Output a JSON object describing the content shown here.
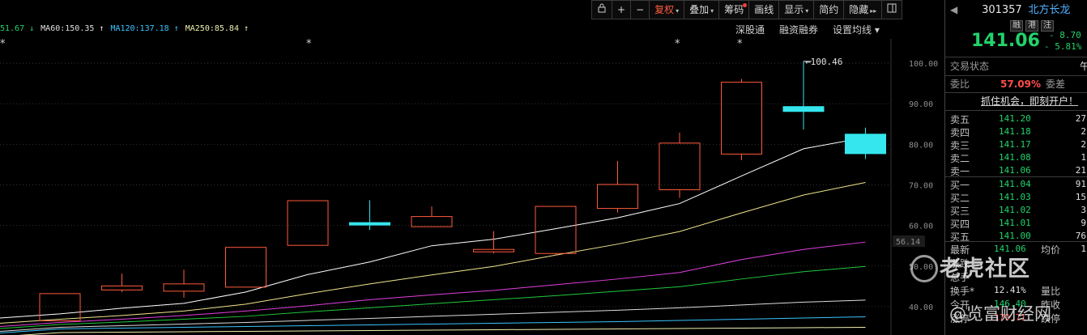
{
  "toolbar": {
    "items": [
      {
        "label": "",
        "icon": "lock-icon"
      },
      {
        "label": "+"
      },
      {
        "label": "−"
      },
      {
        "label": "复权",
        "dropdown": true,
        "active": true
      },
      {
        "label": "叠加",
        "dropdown": true
      },
      {
        "label": "筹码",
        "dot": true
      },
      {
        "label": "画线"
      },
      {
        "label": "显示",
        "dropdown": true
      },
      {
        "label": "简约"
      },
      {
        "label": "隐藏",
        "suffix": "▸▸"
      },
      {
        "label": "",
        "icon": "panel-toggle-icon"
      }
    ]
  },
  "ma_line": [
    {
      "label": "51.67",
      "arrow": "↓",
      "color": "#22d36b"
    },
    {
      "label": "MA60:150.35",
      "arrow": "↑",
      "color": "#e0e0e0"
    },
    {
      "label": "MA120:137.18",
      "arrow": "↑",
      "color": "#39c4ff"
    },
    {
      "label": "MA250:85.84",
      "arrow": "↑",
      "color": "#f0f0b0"
    }
  ],
  "subbar": {
    "items": [
      "深股通",
      "融资融券",
      "设置均线 ▾"
    ]
  },
  "chart_data": {
    "type": "candlestick",
    "ylim": [
      33,
      106
    ],
    "y_ticks": [
      40,
      50,
      60,
      70,
      80,
      90,
      100
    ],
    "current_price_label": "56.14",
    "current_price": 56.14,
    "high_annotation": "100.46",
    "colors": {
      "up": "#ff5a3c",
      "down": "#35e6ee",
      "background": "#000000",
      "grid": "#333333"
    },
    "candles": [
      {
        "open": 36.5,
        "close": 43.2,
        "high": 43.2,
        "low": 36.5
      },
      {
        "open": 44.1,
        "close": 45.1,
        "high": 48.1,
        "low": 43.6
      },
      {
        "open": 43.8,
        "close": 45.6,
        "high": 49.1,
        "low": 42.2
      },
      {
        "open": 44.8,
        "close": 54.6,
        "high": 54.6,
        "low": 44.8
      },
      {
        "open": 55.1,
        "close": 66.1,
        "high": 66.1,
        "low": 55.1
      },
      {
        "open": 60.7,
        "close": 60.2,
        "high": 66.2,
        "low": 58.9
      },
      {
        "open": 59.7,
        "close": 62.2,
        "high": 64.7,
        "low": 59.7
      },
      {
        "open": 53.6,
        "close": 54.1,
        "high": 58.6,
        "low": 53.1
      },
      {
        "open": 53.1,
        "close": 64.7,
        "high": 64.7,
        "low": 52.6
      },
      {
        "open": 64.2,
        "close": 70.1,
        "high": 75.9,
        "low": 63.2
      },
      {
        "open": 68.8,
        "close": 80.3,
        "high": 82.9,
        "low": 66.8
      },
      {
        "open": 77.6,
        "close": 95.3,
        "high": 96.1,
        "low": 76.1
      },
      {
        "open": 89.3,
        "close": 88.1,
        "high": 100.46,
        "low": 83.6
      },
      {
        "open": 82.5,
        "close": 77.7,
        "high": 84.1,
        "low": 76.4
      }
    ],
    "ma_lines": [
      {
        "color": "#ffffff",
        "values": [
          38.2,
          39.6,
          40.8,
          43.6,
          47.9,
          51.0,
          55.0,
          56.6,
          59.2,
          61.9,
          65.4,
          72.2,
          78.9,
          81.7
        ]
      },
      {
        "color": "#f0e68c",
        "values": [
          36.9,
          37.8,
          38.9,
          40.6,
          43.2,
          45.6,
          47.8,
          49.9,
          52.7,
          55.4,
          58.5,
          63.1,
          67.5,
          70.6
        ]
      },
      {
        "color": "#e040e0",
        "values": [
          36.1,
          36.9,
          37.8,
          38.9,
          40.2,
          41.7,
          42.9,
          44.0,
          45.4,
          46.8,
          48.4,
          51.6,
          54.1,
          55.9
        ]
      },
      {
        "color": "#22c93a",
        "values": [
          35.6,
          36.2,
          36.9,
          37.6,
          38.7,
          39.7,
          40.7,
          41.7,
          42.7,
          43.8,
          44.9,
          46.8,
          48.6,
          49.9
        ]
      },
      {
        "color": "#dcdcdc",
        "values": [
          34.9,
          35.3,
          35.7,
          36.1,
          36.6,
          37.1,
          37.6,
          38.1,
          38.6,
          39.1,
          39.7,
          40.4,
          41.1,
          41.6
        ]
      },
      {
        "color": "#39c4ff",
        "values": [
          34.5,
          34.7,
          34.9,
          35.1,
          35.3,
          35.5,
          35.7,
          35.9,
          36.1,
          36.3,
          36.6,
          36.9,
          37.2,
          37.5
        ]
      },
      {
        "color": "#f0f0b0",
        "values": [
          33.6,
          33.7,
          33.8,
          33.9,
          34.0,
          34.1,
          34.2,
          34.3,
          34.4,
          34.5,
          34.6,
          34.7,
          34.8,
          34.9
        ]
      }
    ],
    "star_markers": [
      0,
      5,
      11,
      12
    ]
  },
  "panel": {
    "code": "301357",
    "name": "北方长龙",
    "badges": [
      "融",
      "港",
      "注"
    ],
    "price": "141.06",
    "change": "- 8.70",
    "change_pct": "- 5.81%",
    "status_label": "交易状态",
    "status_value": "午",
    "weibi_label": "委比",
    "weibi_value": "57.09%",
    "weicha_label": "委差",
    "promo": "抓住机会，即刻开户！",
    "asks": [
      {
        "label": "卖五",
        "price": "141.20",
        "vol": "27"
      },
      {
        "label": "卖四",
        "price": "141.18",
        "vol": "2"
      },
      {
        "label": "卖三",
        "price": "141.17",
        "vol": "2"
      },
      {
        "label": "卖二",
        "price": "141.08",
        "vol": "1"
      },
      {
        "label": "卖一",
        "price": "141.06",
        "vol": "21"
      }
    ],
    "bids": [
      {
        "label": "买一",
        "price": "141.04",
        "vol": "91"
      },
      {
        "label": "买二",
        "price": "141.03",
        "vol": "15"
      },
      {
        "label": "买三",
        "price": "141.02",
        "vol": "3"
      },
      {
        "label": "买四",
        "price": "141.01",
        "vol": "9"
      },
      {
        "label": "买五",
        "price": "141.00",
        "vol": "76"
      }
    ],
    "stats": [
      {
        "label": "最新",
        "value": "141.06",
        "label2": "均价",
        "value2": "1"
      },
      {
        "label": "涨跌",
        "value": "",
        "label2": "",
        "value2": ""
      },
      {
        "label": "总手",
        "value": "",
        "label2": "",
        "value2": ""
      },
      {
        "label": "换手*",
        "value": "12.41%",
        "label2": "量比",
        "value2": ""
      },
      {
        "label": "今开",
        "value": "146.40",
        "label2": "昨收",
        "value2": ""
      },
      {
        "label": "涨停",
        "value": "179.71",
        "label2": "跌停",
        "value2": ""
      }
    ]
  },
  "watermarks": [
    "老虎社区",
    "@览富财经网"
  ]
}
